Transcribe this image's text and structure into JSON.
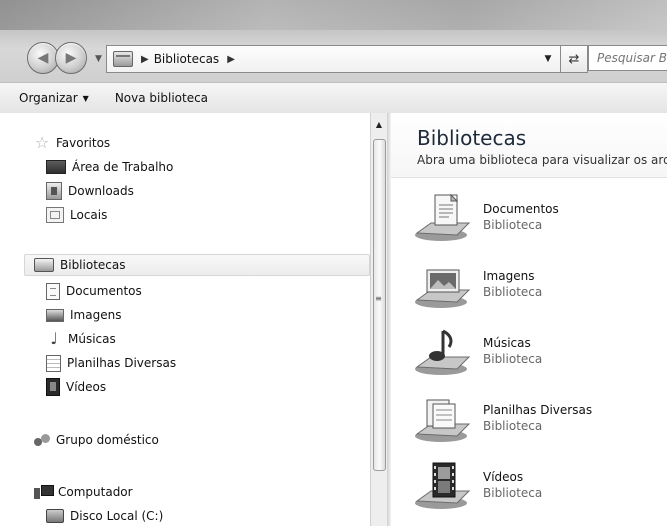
{
  "address": {
    "crumbs": [
      "Bibliotecas"
    ],
    "search_placeholder": "Pesquisar Bibliotecas"
  },
  "toolbar": {
    "organize_label": "Organizar",
    "new_library_label": "Nova biblioteca"
  },
  "navpane": {
    "favorites": {
      "label": "Favoritos",
      "items": [
        "Área de Trabalho",
        "Downloads",
        "Locais"
      ]
    },
    "libraries": {
      "label": "Bibliotecas",
      "items": [
        "Documentos",
        "Imagens",
        "Músicas",
        "Planilhas Diversas",
        "Vídeos"
      ]
    },
    "homegroup": {
      "label": "Grupo doméstico"
    },
    "computer": {
      "label": "Computador",
      "items": [
        "Disco Local (C:)"
      ]
    }
  },
  "content": {
    "title": "Bibliotecas",
    "subtitle": "Abra uma biblioteca para visualizar os arquivos",
    "libraries": [
      {
        "name": "Documentos",
        "type": "Biblioteca",
        "icon": "documents-library-icon"
      },
      {
        "name": "Imagens",
        "type": "Biblioteca",
        "icon": "pictures-library-icon"
      },
      {
        "name": "Músicas",
        "type": "Biblioteca",
        "icon": "music-library-icon"
      },
      {
        "name": "Planilhas Diversas",
        "type": "Biblioteca",
        "icon": "spreadsheets-library-icon"
      },
      {
        "name": "Vídeos",
        "type": "Biblioteca",
        "icon": "videos-library-icon"
      }
    ]
  }
}
